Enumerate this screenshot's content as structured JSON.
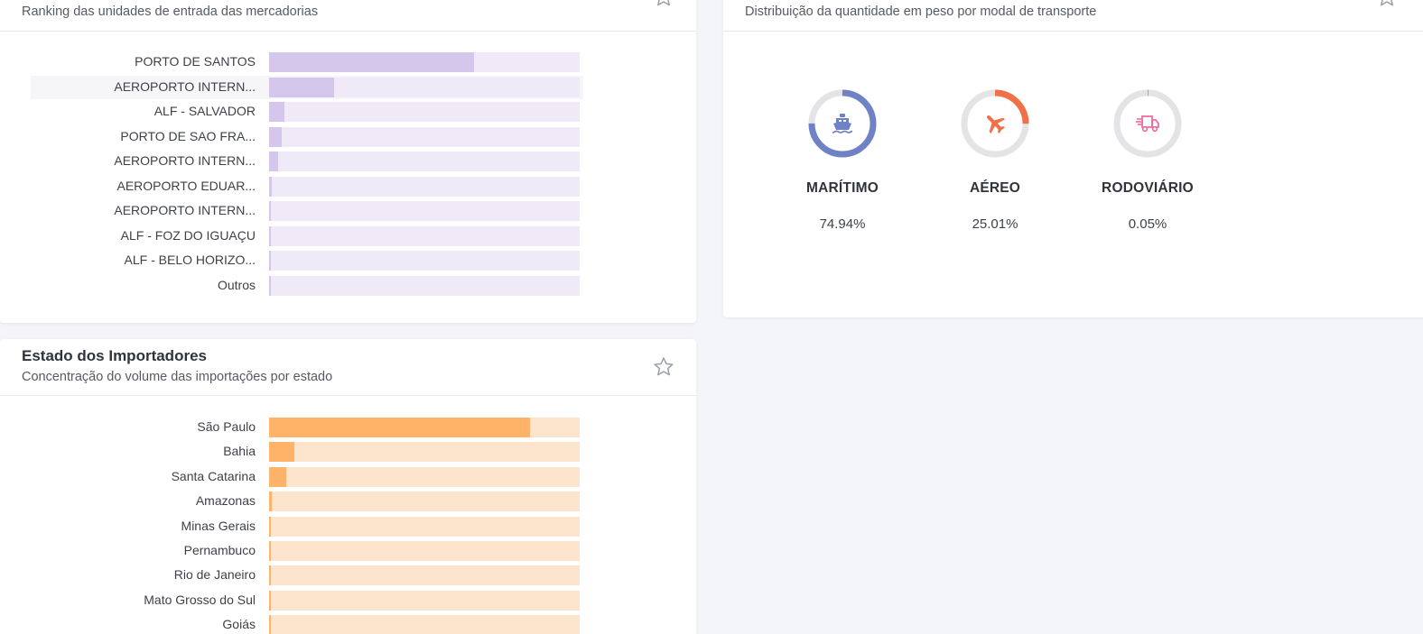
{
  "entrada_card": {
    "subtitle": "Ranking das unidades de entrada das mercadorias",
    "chart_data": {
      "type": "bar",
      "orientation": "horizontal",
      "categories": [
        "PORTO DE SANTOS",
        "AEROPORTO INTERN...",
        "ALF - SALVADOR",
        "PORTO DE SAO FRA...",
        "AEROPORTO INTERN...",
        "AEROPORTO EDUAR...",
        "AEROPORTO INTERN...",
        "ALF - FOZ DO IGUAÇU",
        "ALF - BELO HORIZO...",
        "Outros"
      ],
      "values": [
        66,
        21,
        5,
        4,
        3,
        1,
        0.4,
        0.3,
        0.3,
        0.2
      ],
      "xlim": [
        0,
        100
      ],
      "fill_color": "#d5c6ec",
      "track_color": "#efe9f8"
    }
  },
  "modal_card": {
    "subtitle": "Distribuição da quantidade em peso por modal de transporte",
    "items": [
      {
        "name": "MARÍTIMO",
        "percent_label": "74.94%",
        "value": 74.94,
        "color": "#6f82c6",
        "icon": "ship-icon"
      },
      {
        "name": "AÉREO",
        "percent_label": "25.01%",
        "value": 25.01,
        "color": "#f0704a",
        "icon": "airplane-icon"
      },
      {
        "name": "RODOVIÁRIO",
        "percent_label": "0.05%",
        "value": 0.05,
        "color": "#ec6b9e",
        "icon": "truck-icon"
      }
    ],
    "ring_track_color": "#e4e4e6"
  },
  "estado_card": {
    "title": "Estado dos Importadores",
    "subtitle": "Concentração do volume das importações por estado",
    "chart_data": {
      "type": "bar",
      "orientation": "horizontal",
      "categories": [
        "São Paulo",
        "Bahia",
        "Santa Catarina",
        "Amazonas",
        "Minas Gerais",
        "Pernambuco",
        "Rio de Janeiro",
        "Mato Grosso do Sul",
        "Goiás"
      ],
      "values": [
        84,
        8,
        5.5,
        0.8,
        0.6,
        0.5,
        0.4,
        0.3,
        0.3
      ],
      "xlim": [
        0,
        100
      ],
      "fill_color": "#ffb369",
      "track_color": "#fde5cd"
    }
  }
}
